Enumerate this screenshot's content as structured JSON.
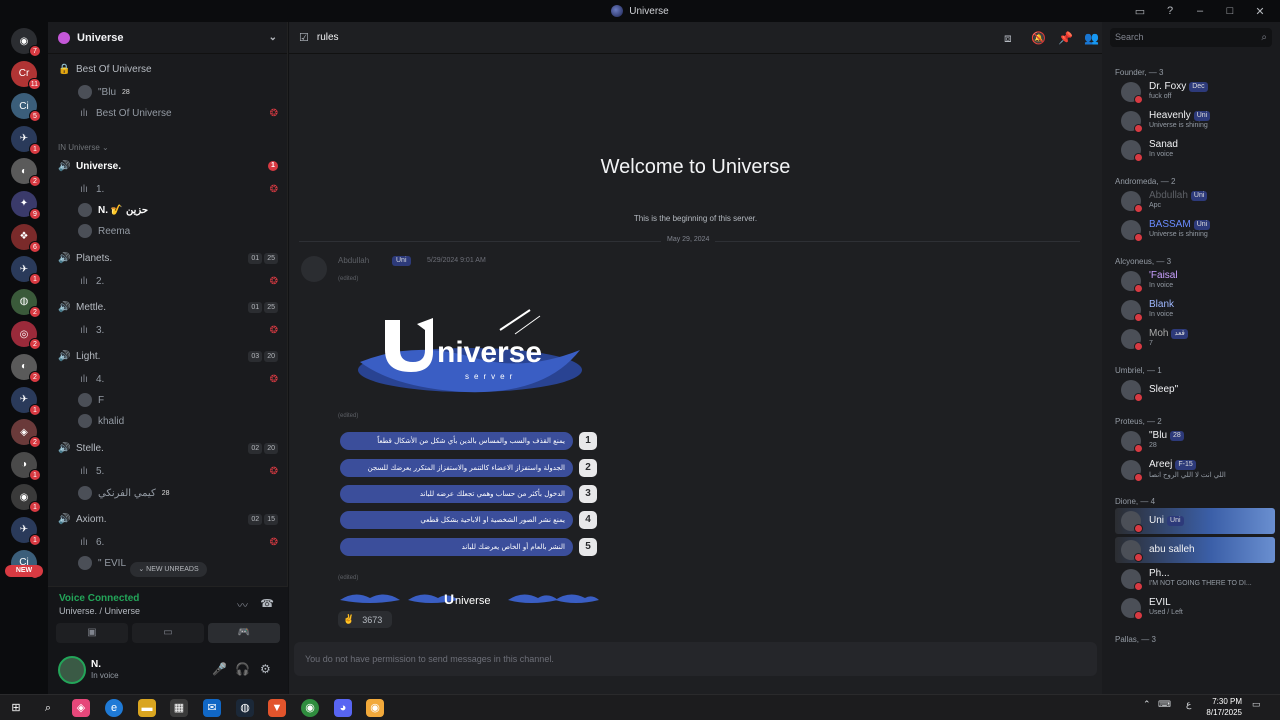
{
  "window": {
    "title": "Universe"
  },
  "rail": {
    "servers": [
      {
        "label": "◉",
        "badge": "7",
        "color": "#2b2d31"
      },
      {
        "label": "Cr",
        "badge": "11",
        "color": "#b03434"
      },
      {
        "label": "Ci",
        "badge": "5",
        "color": "#3b5e7a"
      },
      {
        "label": "✈",
        "badge": "1",
        "color": "#2a3a5a"
      },
      {
        "label": "◐",
        "badge": "2",
        "color": "#5a5a5a"
      },
      {
        "label": "✦",
        "badge": "9",
        "color": "#3a3a6a"
      },
      {
        "label": "❖",
        "badge": "6",
        "color": "#7a2a2a"
      },
      {
        "label": "✈",
        "badge": "1",
        "color": "#2a3a5a"
      },
      {
        "label": "◍",
        "badge": "2",
        "color": "#3a5a3a"
      },
      {
        "label": "◎",
        "badge": "2",
        "color": "#9a2a3a"
      },
      {
        "label": "◐",
        "badge": "2",
        "color": "#5a5a5a"
      },
      {
        "label": "✈",
        "badge": "1",
        "color": "#2a3a5a"
      },
      {
        "label": "◈",
        "badge": "2",
        "color": "#6a3a3a"
      },
      {
        "label": "◑",
        "badge": "1",
        "color": "#4a4a4a"
      },
      {
        "label": "◉",
        "badge": "1",
        "color": "#3a3a3a"
      },
      {
        "label": "✈",
        "badge": "1",
        "color": "#2a3a5a"
      },
      {
        "label": "Ci",
        "badge": "5",
        "color": "#3b5e7a"
      }
    ],
    "new_label": "NEW"
  },
  "sidebar": {
    "server_name": "Universe",
    "items": [
      {
        "type": "cat",
        "label": "Best Of Universe",
        "icon": "🔒"
      },
      {
        "type": "user",
        "label": "\"Blu",
        "tag": "28"
      },
      {
        "type": "sub",
        "label": "Best Of Universe",
        "icon": "ılı",
        "event": true
      },
      {
        "type": "dim",
        "label": "IN Universe ⌄"
      },
      {
        "type": "cat-active",
        "label": "Universe.",
        "icon": "🔊",
        "unread": "1"
      },
      {
        "type": "sub",
        "label": "1.",
        "icon": "ılı",
        "event": true
      },
      {
        "type": "user",
        "label": "N. 🎷 حزين",
        "bold": true
      },
      {
        "type": "user",
        "label": "Reema"
      },
      {
        "type": "cat",
        "label": "Planets.",
        "icon": "🔊",
        "c1": "01",
        "c2": "25"
      },
      {
        "type": "sub",
        "label": "2.",
        "icon": "ılı",
        "event": true
      },
      {
        "type": "cat",
        "label": "Mettle.",
        "icon": "🔊",
        "c1": "01",
        "c2": "25"
      },
      {
        "type": "sub",
        "label": "3.",
        "icon": "ılı",
        "event": true
      },
      {
        "type": "cat",
        "label": "Light.",
        "icon": "🔊",
        "c1": "03",
        "c2": "20"
      },
      {
        "type": "sub",
        "label": "4.",
        "icon": "ılı",
        "event": true
      },
      {
        "type": "user",
        "label": "F"
      },
      {
        "type": "user",
        "label": "khalid"
      },
      {
        "type": "cat",
        "label": "Stelle.",
        "icon": "🔊",
        "c1": "02",
        "c2": "20"
      },
      {
        "type": "sub",
        "label": "5.",
        "icon": "ılı",
        "event": true
      },
      {
        "type": "user",
        "label": "كيمي الفرنكي",
        "tag": "28"
      },
      {
        "type": "cat",
        "label": "Axiom.",
        "icon": "🔊",
        "c1": "02",
        "c2": "15"
      },
      {
        "type": "sub",
        "label": "6.",
        "icon": "ılı",
        "event": true
      },
      {
        "type": "user",
        "label": "\" EVIL"
      }
    ],
    "new_unreads": "NEW UNREADS"
  },
  "voice": {
    "status": "Voice Connected",
    "location": "Universe. / Universe"
  },
  "user": {
    "name": "N.",
    "status": "In voice"
  },
  "main": {
    "channel": "rules",
    "welcome": "Welcome to Universe",
    "welcome_sub": "This is the beginning of this server.",
    "date": "May 29, 2024",
    "message": {
      "author": "Abdullah",
      "tag": "Uni",
      "time": "5/29/2024 9:01 AM",
      "edited": "(edited)",
      "logo_main": "niverse",
      "logo_sub": "server",
      "rules": [
        {
          "n": "1",
          "text": "يمنع القذف والسب والمساس بالدين بأي شكل من الأشكال قطعاً"
        },
        {
          "n": "2",
          "text": "الجدولة واستفزاز الاعضاء كالتنمر والاستفزاز المتكرر يعرضك للسجن"
        },
        {
          "n": "3",
          "text": "الدخول بأكثر من حساب وهمي تجعلك عرضه للباند"
        },
        {
          "n": "4",
          "text": "يمنع نشر الصور الشخصية او الاباحية بشكل قطعي"
        },
        {
          "n": "5",
          "text": "النشر بالعام أو الخاص يعرضك للباند"
        }
      ],
      "footer_logo": "niverse",
      "reaction_count": "3673"
    },
    "composer": "You do not have permission to send messages in this channel."
  },
  "members": {
    "search_placeholder": "Search",
    "groups": [
      {
        "title": "Founder, — 3",
        "members": [
          {
            "name": "Dr. Foxy",
            "tag": "Dec",
            "status": "fuck off"
          },
          {
            "name": "Heavenly",
            "tag": "Uni",
            "status": "Universe is shining"
          },
          {
            "name": "Sanad",
            "tag": "",
            "status": "In voice"
          }
        ]
      },
      {
        "title": "Andromeda, — 2",
        "members": [
          {
            "name": "Abdullah",
            "tag": "Uni",
            "status": "Apc",
            "dim": true
          },
          {
            "name": "BASSAM",
            "tag": "Uni",
            "status": "Universe is shining",
            "color": "#6a8cff"
          }
        ]
      },
      {
        "title": "Alcyoneus, — 3",
        "members": [
          {
            "name": "'Faisal",
            "tag": "",
            "status": "In voice",
            "color": "#c9a0ff"
          },
          {
            "name": "Blank",
            "tag": "",
            "status": "In voice",
            "color": "#9fb8ff"
          },
          {
            "name": "Moh",
            "tag": "قعد",
            "status": "7",
            "color": "#aaaaaa"
          }
        ]
      },
      {
        "title": "Umbriel, — 1",
        "members": [
          {
            "name": "Sleep\"",
            "tag": "",
            "status": ""
          }
        ]
      },
      {
        "title": "Proteus, — 2",
        "members": [
          {
            "name": "\"Blu",
            "tag": "28",
            "status": "28"
          },
          {
            "name": "Areej",
            "tag": "F-15",
            "status": "اللي انت لا اللي الروح انصا"
          }
        ]
      },
      {
        "title": "Dione, — 4",
        "members": [
          {
            "name": "Uni",
            "tag": "Uni",
            "status": "",
            "hl": true
          },
          {
            "name": "abu salleh",
            "tag": "",
            "status": "",
            "hl": true
          },
          {
            "name": "Ph...",
            "tag": "",
            "status": "I'M NOT GOING THERE TO DI..."
          },
          {
            "name": "EVIL",
            "tag": "",
            "status": "Used / Left"
          }
        ]
      },
      {
        "title": "Pallas, — 3",
        "members": []
      }
    ]
  },
  "taskbar": {
    "time": "7:30 PM",
    "date": "8/17/2025"
  }
}
